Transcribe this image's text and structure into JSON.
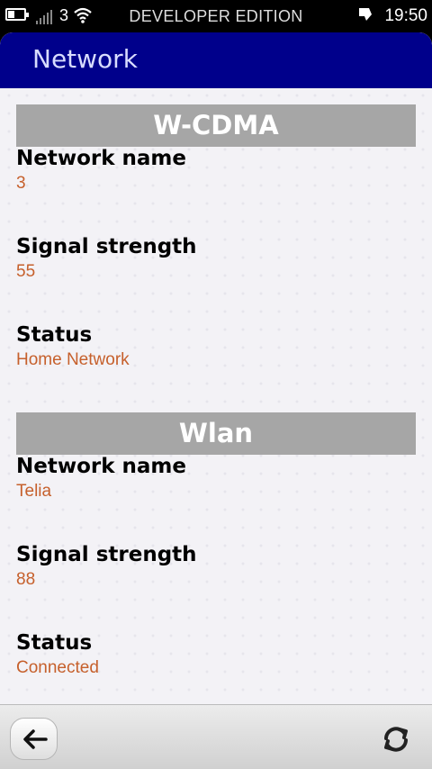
{
  "status_bar": {
    "carrier": "3",
    "edition": "DEVELOPER EDITION",
    "time": "19:50",
    "icons": [
      "battery-icon",
      "signal-icon",
      "wifi-icon",
      "alarm-icon"
    ]
  },
  "header": {
    "title": "Network"
  },
  "sections": [
    {
      "title": "W-CDMA",
      "fields": [
        {
          "label": "Network name",
          "value": "3"
        },
        {
          "label": "Signal strength",
          "value": "55"
        },
        {
          "label": "Status",
          "value": "Home Network"
        }
      ]
    },
    {
      "title": "Wlan",
      "fields": [
        {
          "label": "Network name",
          "value": "Telia"
        },
        {
          "label": "Signal strength",
          "value": "88"
        },
        {
          "label": "Status",
          "value": "Connected"
        }
      ]
    }
  ],
  "toolbar": {
    "icons": [
      "back-arrow-icon",
      "refresh-icon"
    ]
  },
  "colors": {
    "header_bg": "#00008b",
    "value_text": "#c6602c",
    "section_bg": "#a6a6a6"
  }
}
